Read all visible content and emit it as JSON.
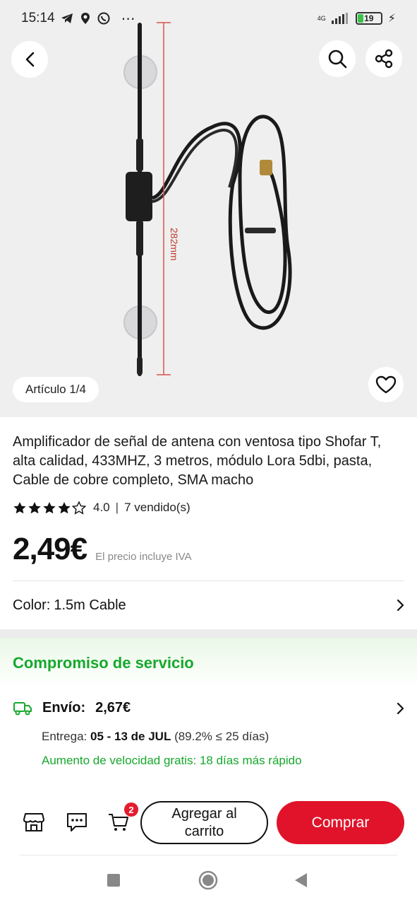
{
  "status_bar": {
    "time": "15:14",
    "network": "4G",
    "battery": "19"
  },
  "gallery": {
    "counter": "Artículo 1/4",
    "dimension_label": "282mm"
  },
  "product": {
    "title": "Amplificador de señal de antena con ventosa tipo Shofar T, alta calidad, 433MHZ, 3 metros, módulo Lora 5dbi, pasta, Cable de cobre completo, SMA macho",
    "rating": "4.0",
    "rating_stars": 4,
    "sold": "7 vendido(s)",
    "price": "2,49€",
    "vat_note": "El precio incluye IVA",
    "color_label": "Color:",
    "color_value": "1.5m Cable"
  },
  "service": {
    "title": "Compromiso de servicio",
    "shipping_label": "Envío:",
    "shipping_price": "2,67€",
    "delivery_label": "Entrega:",
    "delivery_dates": "05 - 13 de JUL",
    "delivery_stat": "(89.2% ≤ 25 días)",
    "speed_note": "Aumento de velocidad gratis: 18 días más rápido"
  },
  "actions": {
    "cart_count": "2",
    "add_to_cart": "Agregar al carrito",
    "buy": "Comprar"
  },
  "colors": {
    "accent_red": "#e0132a",
    "service_green": "#17a82d"
  }
}
